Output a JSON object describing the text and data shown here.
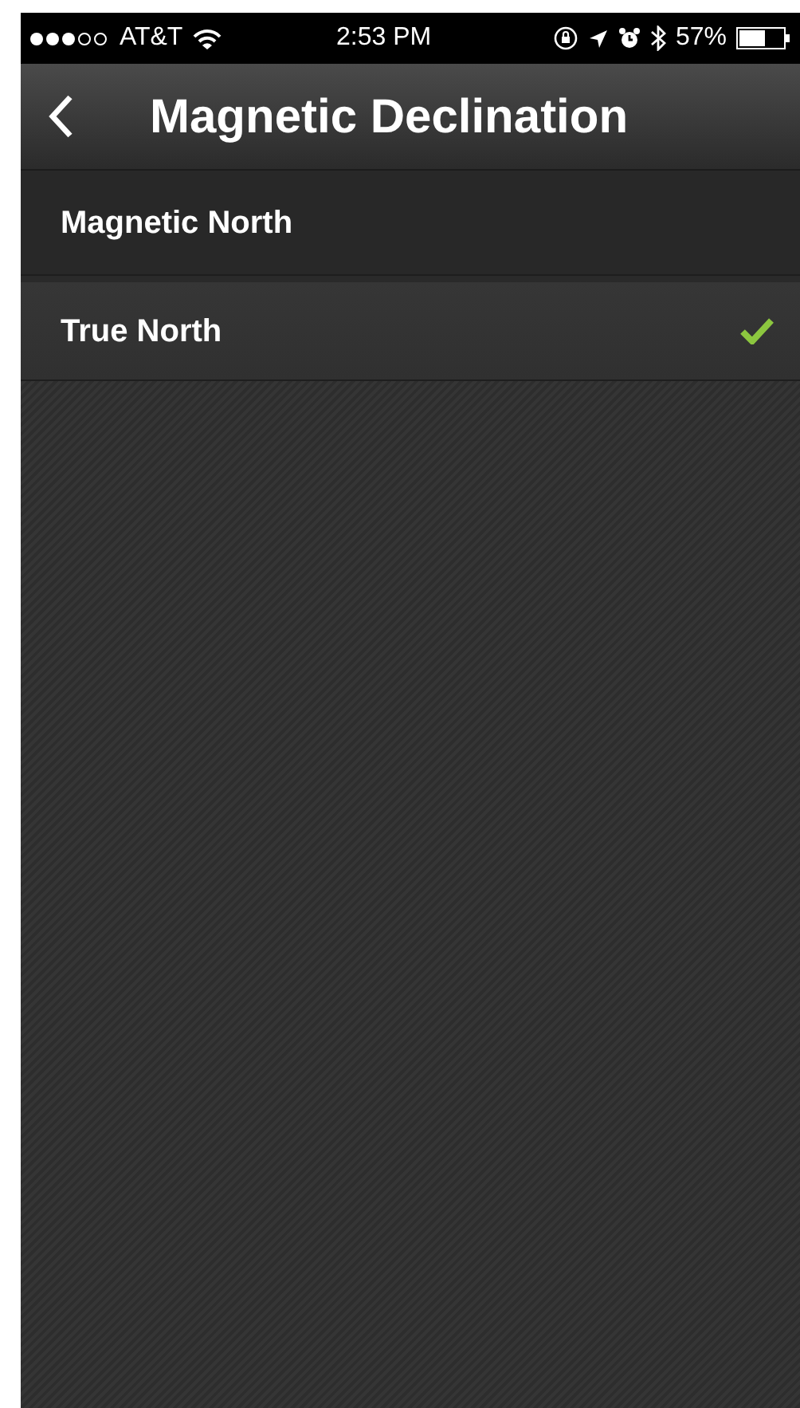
{
  "status_bar": {
    "carrier": "AT&T",
    "time": "2:53 PM",
    "battery": "57%"
  },
  "nav_bar": {
    "title": "Magnetic Declination"
  },
  "options": [
    {
      "label": "Magnetic North",
      "selected": false
    },
    {
      "label": "True North",
      "selected": true
    }
  ]
}
